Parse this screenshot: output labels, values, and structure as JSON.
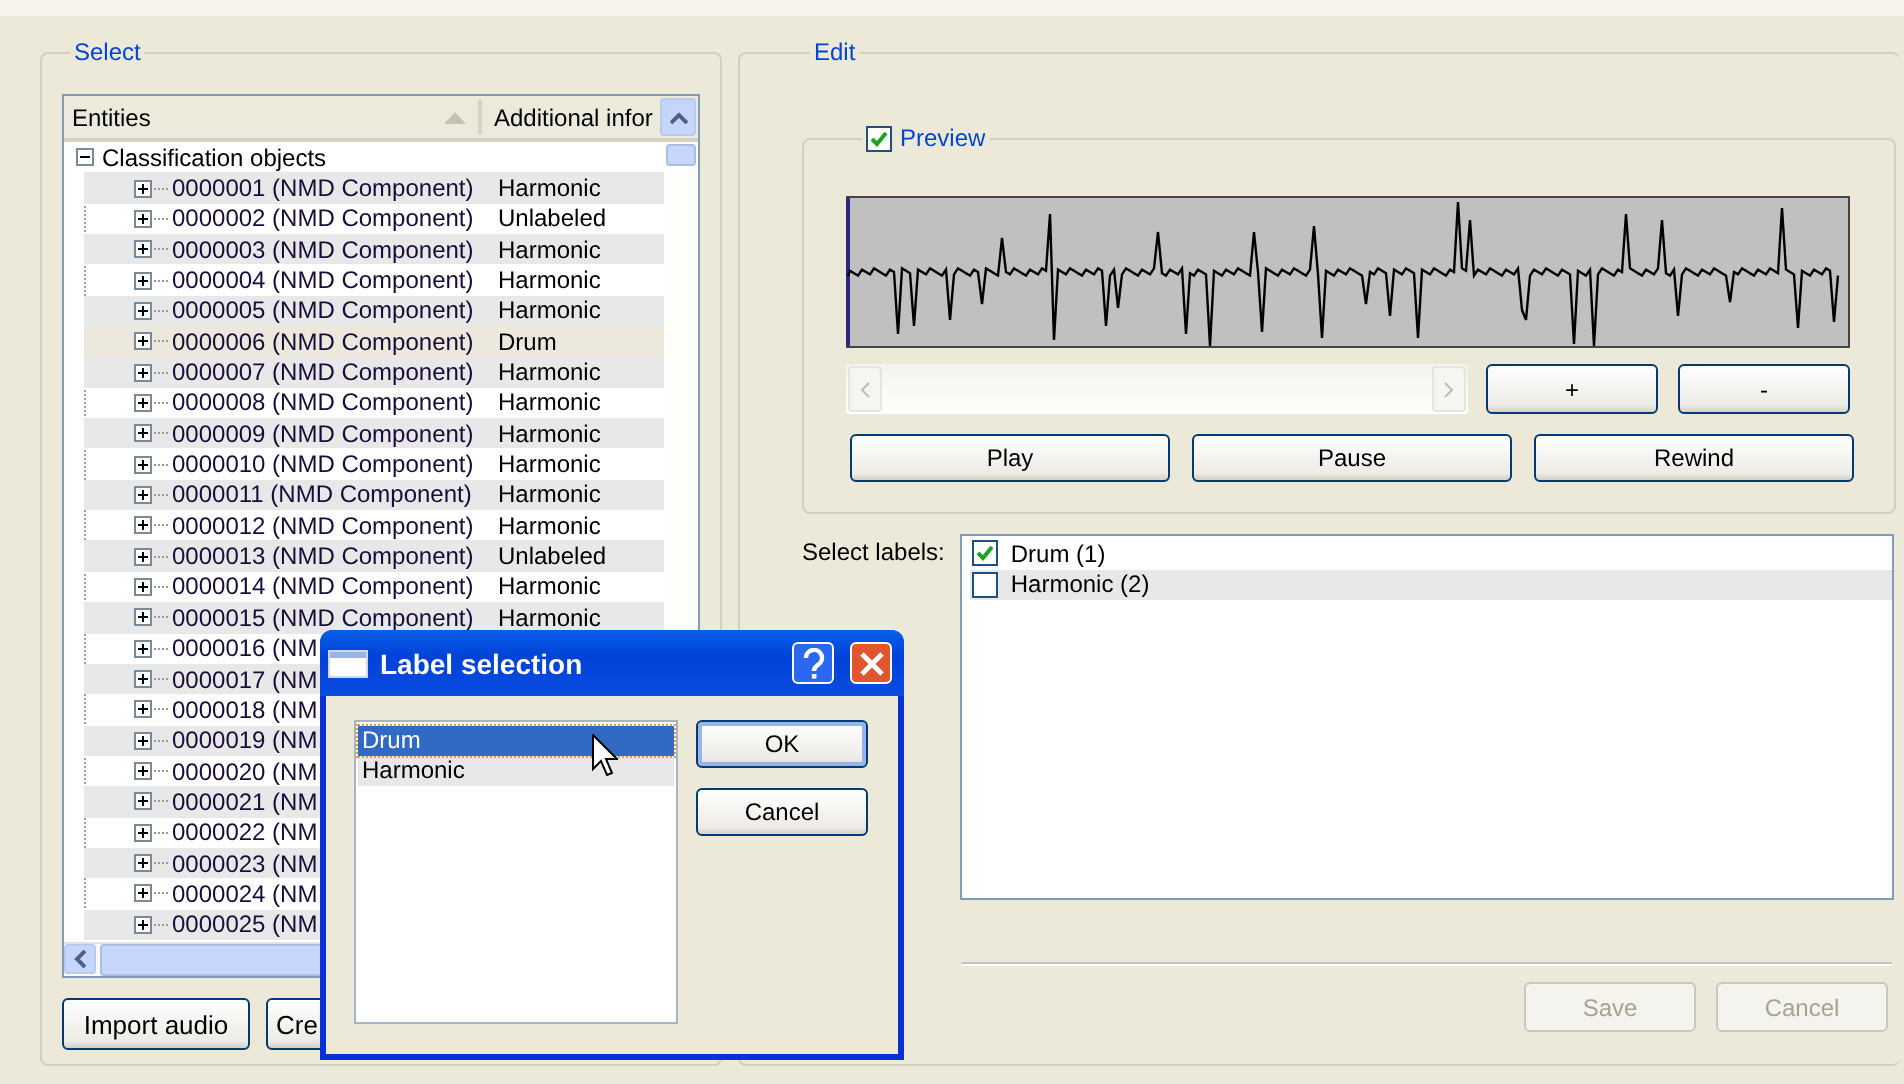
{
  "select_panel": {
    "title": "Select",
    "tree": {
      "columns": [
        "Entities",
        "Additional infor"
      ],
      "items": [
        {
          "label": "Classification objects",
          "expanded": true,
          "children": [
            {
              "entity": "0000001 (NMD Component)",
              "info": "Harmonic",
              "expanded": false,
              "selected": false
            },
            {
              "entity": "0000002 (NMD Component)",
              "info": "Unlabeled",
              "expanded": false,
              "selected": false
            },
            {
              "entity": "0000003 (NMD Component)",
              "info": "Harmonic",
              "expanded": false,
              "selected": false
            },
            {
              "entity": "0000004 (NMD Component)",
              "info": "Harmonic",
              "expanded": false,
              "selected": false
            },
            {
              "entity": "0000005 (NMD Component)",
              "info": "Harmonic",
              "expanded": false,
              "selected": false
            },
            {
              "entity": "0000006 (NMD Component)",
              "info": "Drum",
              "expanded": false,
              "selected": true
            },
            {
              "entity": "0000007 (NMD Component)",
              "info": "Harmonic",
              "expanded": false,
              "selected": false
            },
            {
              "entity": "0000008 (NMD Component)",
              "info": "Harmonic",
              "expanded": false,
              "selected": false
            },
            {
              "entity": "0000009 (NMD Component)",
              "info": "Harmonic",
              "expanded": false,
              "selected": false
            },
            {
              "entity": "0000010 (NMD Component)",
              "info": "Harmonic",
              "expanded": false,
              "selected": false
            },
            {
              "entity": "0000011 (NMD Component)",
              "info": "Harmonic",
              "expanded": false,
              "selected": false
            },
            {
              "entity": "0000012 (NMD Component)",
              "info": "Harmonic",
              "expanded": false,
              "selected": false
            },
            {
              "entity": "0000013 (NMD Component)",
              "info": "Unlabeled",
              "expanded": false,
              "selected": false
            },
            {
              "entity": "0000014 (NMD Component)",
              "info": "Harmonic",
              "expanded": false,
              "selected": false
            },
            {
              "entity": "0000015 (NMD Component)",
              "info": "Harmonic",
              "expanded": false,
              "selected": false
            },
            {
              "entity": "0000016 (NM",
              "expanded": false,
              "selected": false
            },
            {
              "entity": "0000017 (NM",
              "expanded": false,
              "selected": false
            },
            {
              "entity": "0000018 (NM",
              "expanded": false,
              "selected": false
            },
            {
              "entity": "0000019 (NM",
              "expanded": false,
              "selected": false
            },
            {
              "entity": "0000020 (NM",
              "expanded": false,
              "selected": false
            },
            {
              "entity": "0000021 (NM",
              "expanded": false,
              "selected": false
            },
            {
              "entity": "0000022 (NM",
              "expanded": false,
              "selected": false
            },
            {
              "entity": "0000023 (NM",
              "expanded": false,
              "selected": false
            },
            {
              "entity": "0000024 (NM",
              "expanded": false,
              "selected": false
            },
            {
              "entity": "0000025 (NM",
              "expanded": false,
              "selected": false
            }
          ]
        }
      ]
    },
    "buttons": [
      "Import audio",
      "Cre"
    ]
  },
  "edit_panel": {
    "title": "Edit",
    "preview": {
      "label": "Preview",
      "checked": true,
      "zoom_buttons": [
        "+",
        "-"
      ],
      "transport_buttons": [
        "Play",
        "Pause",
        "Rewind"
      ]
    },
    "labels_caption": "Select labels:",
    "labels": [
      {
        "label": "Drum (1)",
        "checked": true
      },
      {
        "label": "Harmonic (2)",
        "checked": false
      }
    ],
    "buttons": [
      {
        "label": "Save",
        "disabled": true
      },
      {
        "label": "Cancel",
        "disabled": true
      }
    ]
  },
  "dialog": {
    "title": "Label selection",
    "items": [
      {
        "label": "Drum",
        "selected": true
      },
      {
        "label": "Harmonic",
        "selected": false
      }
    ],
    "buttons": [
      "OK",
      "Cancel"
    ]
  }
}
